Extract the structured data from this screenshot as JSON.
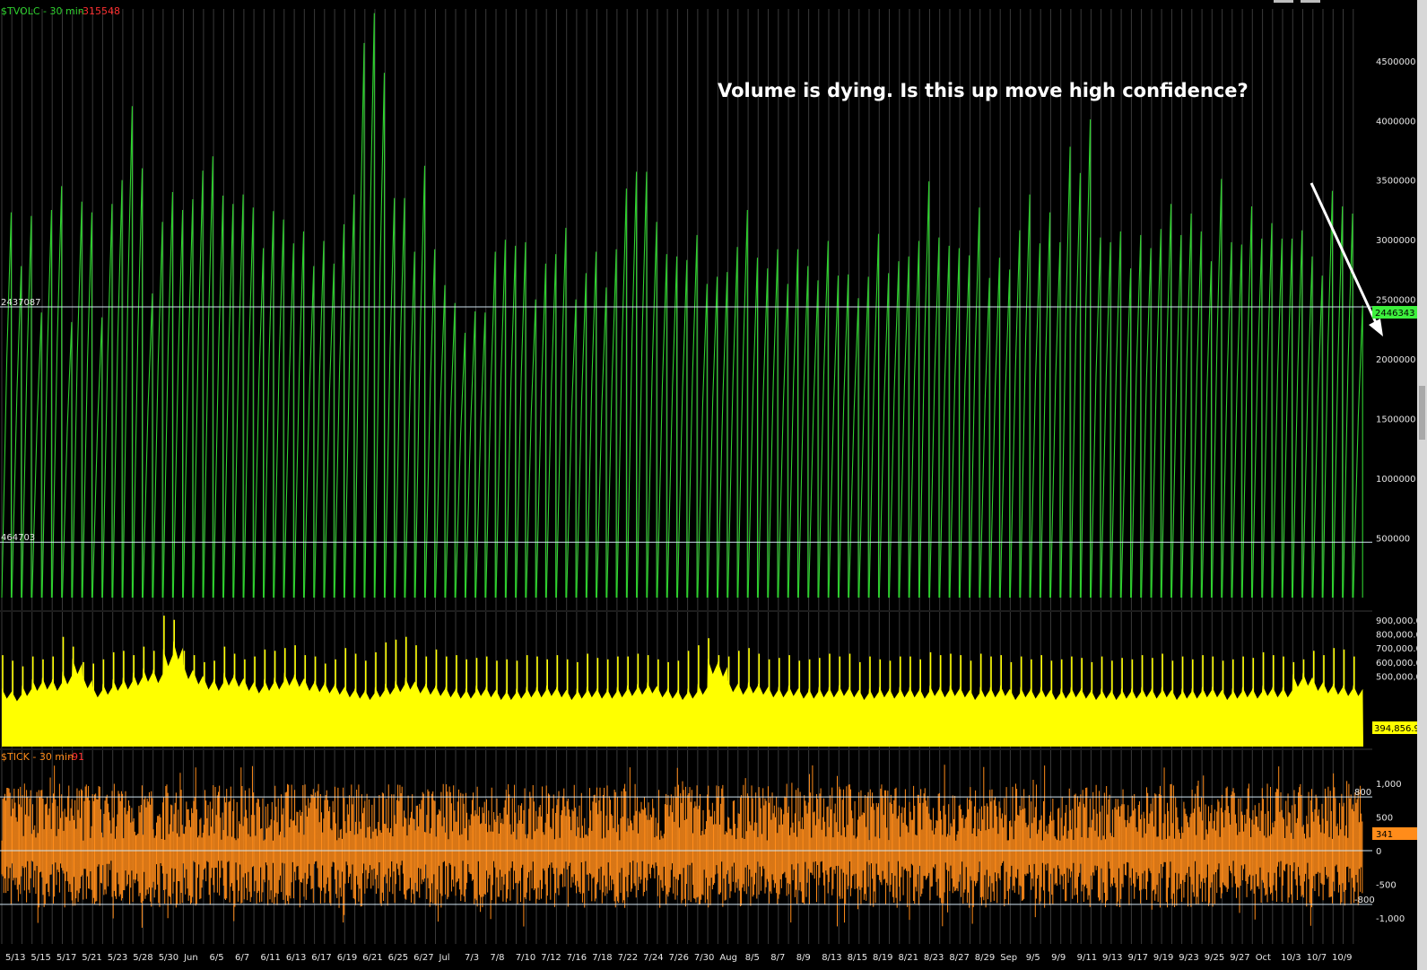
{
  "chart_data": [
    {
      "type": "line",
      "panel": "cumulative-volume",
      "series_label": "$TVOLC - 30 min",
      "series_value": "-315548",
      "color": "#2fd12f",
      "ylim": [
        0,
        4950000
      ],
      "yticks": [
        "4500000",
        "4000000",
        "3500000",
        "3000000",
        "2500000",
        "2000000",
        "1500000",
        "1000000",
        "500000"
      ],
      "ytick_values": [
        4500000,
        4000000,
        3500000,
        3000000,
        2500000,
        2000000,
        1500000,
        1000000,
        500000
      ],
      "hlines": [
        {
          "label": "2437087",
          "value": 2437087
        },
        {
          "label": "464703",
          "value": 464703
        }
      ],
      "last_value_label": "2446343",
      "last_value": 2446343,
      "daily_totals": [
        3230000,
        2780000,
        3200000,
        2390000,
        3250000,
        3450000,
        2310000,
        3320000,
        3230000,
        2350000,
        3300000,
        3500000,
        4120000,
        3600000,
        2550000,
        3150000,
        3400000,
        3250000,
        3340000,
        3580000,
        3700000,
        3370000,
        3300000,
        3380000,
        3270000,
        2930000,
        3240000,
        3170000,
        2970000,
        3070000,
        2780000,
        2990000,
        2800000,
        3130000,
        3380000,
        4650000,
        4900000,
        4400000,
        3350000,
        3350000,
        2900000,
        3620000,
        2920000,
        2620000,
        2470000,
        2220000,
        2400000,
        2390000,
        2900000,
        3000000,
        2950000,
        2980000,
        2500000,
        2800000,
        2880000,
        3100000,
        2500000,
        2720000,
        2900000,
        2600000,
        2920000,
        3430000,
        3570000,
        3570000,
        3150000,
        2880000,
        2860000,
        2830000,
        3040000,
        2630000,
        2690000,
        2730000,
        2940000,
        3250000,
        2850000,
        2760000,
        2920000,
        2630000,
        2920000,
        2780000,
        2660000,
        2990000,
        2700000,
        2710000,
        2510000,
        2690000,
        3050000,
        2720000,
        2820000,
        2860000,
        2990000,
        3490000,
        3020000,
        2950000,
        2930000,
        2870000,
        3270000,
        2680000,
        2850000,
        2750000,
        3080000,
        3380000,
        2970000,
        3230000,
        2980000,
        3780000,
        3560000,
        4010000,
        3020000,
        2980000,
        3070000,
        2760000,
        3040000,
        2930000,
        3090000,
        3300000,
        3040000,
        3220000,
        3070000,
        2820000,
        3510000,
        2980000,
        2960000,
        3280000,
        3010000,
        3140000,
        3010000,
        3010000,
        3080000,
        2860000,
        2700000,
        3410000,
        3280000,
        3220000,
        2450000
      ],
      "annotation": "Volume is dying.  Is this up move high confidence?"
    },
    {
      "type": "area",
      "panel": "volume",
      "color": "#ffff00",
      "ylim": [
        0,
        950000
      ],
      "yticks": [
        "900,000.00",
        "800,000.00",
        "700,000.00",
        "600,000.00",
        "500,000.00"
      ],
      "ytick_values": [
        900000,
        800000,
        700000,
        600000,
        500000
      ],
      "last_value_label": "394,856.93",
      "last_value": 394856.93,
      "spike_values": [
        650000,
        610000,
        570000,
        640000,
        620000,
        640000,
        780000,
        710000,
        600000,
        590000,
        620000,
        670000,
        680000,
        650000,
        710000,
        680000,
        930000,
        900000,
        680000,
        650000,
        600000,
        610000,
        710000,
        660000,
        620000,
        640000,
        690000,
        680000,
        700000,
        720000,
        650000,
        640000,
        590000,
        620000,
        700000,
        660000,
        610000,
        670000,
        740000,
        760000,
        780000,
        720000,
        640000,
        690000,
        640000,
        650000,
        620000,
        630000,
        640000,
        610000,
        620000,
        610000,
        650000,
        640000,
        620000,
        650000,
        620000,
        600000,
        660000,
        630000,
        620000,
        640000,
        640000,
        660000,
        650000,
        620000,
        600000,
        610000,
        680000,
        720000,
        770000,
        650000,
        640000,
        680000,
        700000,
        660000,
        620000,
        630000,
        650000,
        610000,
        620000,
        630000,
        660000,
        640000,
        660000,
        600000,
        640000,
        620000,
        610000,
        640000,
        640000,
        620000,
        670000,
        650000,
        660000,
        650000,
        610000,
        660000,
        640000,
        650000,
        600000,
        640000,
        620000,
        650000,
        610000,
        620000,
        640000,
        630000,
        600000,
        640000,
        610000,
        630000,
        620000,
        650000,
        630000,
        660000,
        610000,
        640000,
        620000,
        650000,
        640000,
        610000,
        620000,
        640000,
        630000,
        670000,
        650000,
        640000,
        600000,
        620000,
        680000,
        650000,
        700000,
        690000,
        640000
      ],
      "base_values": [
        370000,
        350000,
        390000,
        430000,
        440000,
        430000,
        480000,
        560000,
        450000,
        380000,
        400000,
        430000,
        440000,
        470000,
        500000,
        490000,
        620000,
        670000,
        520000,
        480000,
        440000,
        430000,
        470000,
        460000,
        430000,
        410000,
        430000,
        440000,
        470000,
        460000,
        430000,
        420000,
        410000,
        400000,
        380000,
        370000,
        360000,
        380000,
        400000,
        420000,
        440000,
        410000,
        400000,
        390000,
        380000,
        370000,
        370000,
        390000,
        380000,
        360000,
        360000,
        370000,
        380000,
        380000,
        390000,
        380000,
        360000,
        370000,
        380000,
        370000,
        370000,
        380000,
        390000,
        400000,
        410000,
        380000,
        370000,
        360000,
        370000,
        400000,
        560000,
        540000,
        420000,
        400000,
        410000,
        400000,
        380000,
        380000,
        390000,
        370000,
        370000,
        380000,
        380000,
        390000,
        380000,
        360000,
        370000,
        380000,
        370000,
        380000,
        380000,
        370000,
        390000,
        380000,
        390000,
        380000,
        360000,
        380000,
        380000,
        390000,
        360000,
        380000,
        370000,
        380000,
        360000,
        370000,
        380000,
        370000,
        360000,
        370000,
        360000,
        370000,
        370000,
        380000,
        370000,
        380000,
        360000,
        370000,
        370000,
        380000,
        380000,
        360000,
        370000,
        380000,
        370000,
        390000,
        380000,
        380000,
        460000,
        470000,
        430000,
        410000,
        400000,
        390000,
        390000
      ]
    },
    {
      "type": "bar",
      "panel": "tick",
      "series_label": "$TICK - 30 min",
      "series_value": "-91",
      "color": "#ff8c1a",
      "ylim": [
        -1400,
        1400
      ],
      "yticks": [
        "1,000",
        "500",
        "0",
        "-500",
        "-1,000"
      ],
      "ytick_values": [
        1000,
        500,
        0,
        -500,
        -1000
      ],
      "hlines": [
        {
          "label": "800",
          "value": 800
        },
        {
          "label": "-800",
          "value": -800
        }
      ],
      "last_value_label": "341",
      "last_value": 341
    }
  ],
  "x_axis": {
    "labels": [
      "5/13",
      "5/15",
      "5/17",
      "5/21",
      "5/23",
      "5/28",
      "5/30",
      "Jun",
      "6/5",
      "6/7",
      "6/11",
      "6/13",
      "6/17",
      "6/19",
      "6/21",
      "6/25",
      "6/27",
      "Jul",
      "7/3",
      "7/8",
      "7/10",
      "7/12",
      "7/16",
      "7/18",
      "7/22",
      "7/24",
      "7/26",
      "7/30",
      "Aug",
      "8/5",
      "8/7",
      "8/9",
      "8/13",
      "8/15",
      "8/19",
      "8/21",
      "8/23",
      "8/27",
      "8/29",
      "Sep",
      "9/5",
      "9/9",
      "9/11",
      "9/13",
      "9/17",
      "9/19",
      "9/23",
      "9/25",
      "9/27",
      "Oct",
      "10/3",
      "10/7",
      "10/9"
    ]
  },
  "colors": {
    "background": "#000000",
    "grid": "#3a3a3a",
    "hline": "#cfe3ef",
    "volume_line": "#2fd12f",
    "volume_tag": "#3df03d",
    "tvolc_value": "#ff3030",
    "tick_label": "#ff8c1a",
    "tick_value": "#ff3030",
    "arrow": "#ffffff"
  }
}
